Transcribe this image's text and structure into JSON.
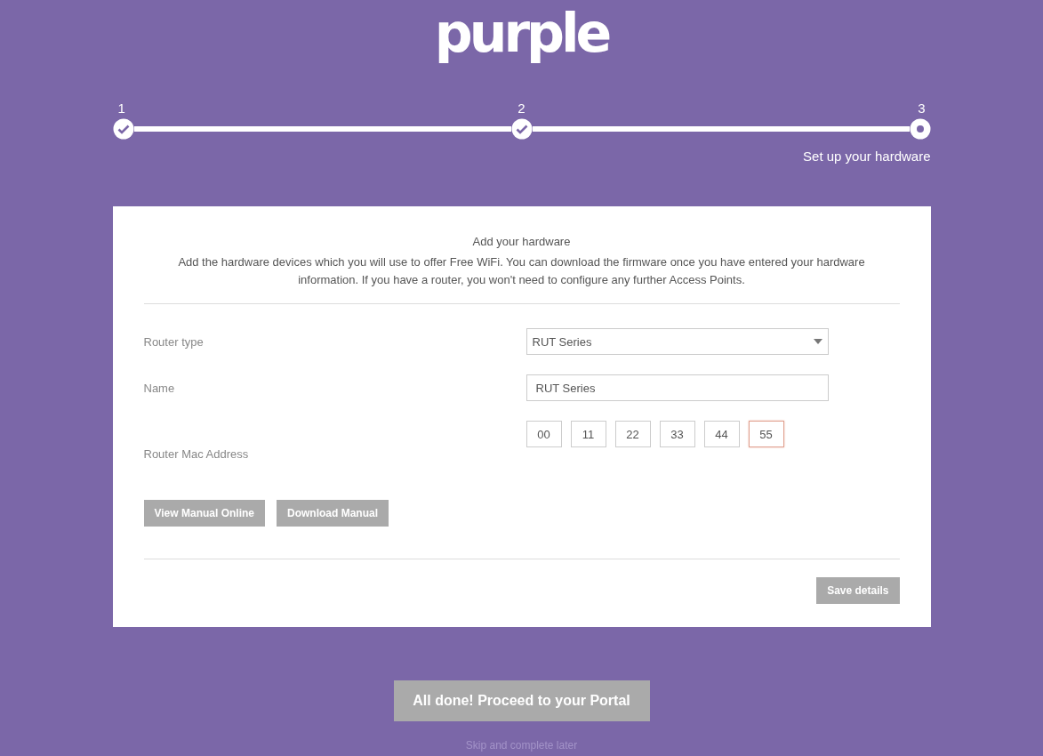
{
  "logo": {
    "text": "purple"
  },
  "steps": [
    {
      "number": "1",
      "completed": true
    },
    {
      "number": "2",
      "completed": true
    },
    {
      "number": "3",
      "completed": false
    }
  ],
  "step_caption": "Set up your hardware",
  "card": {
    "title": "Add your hardware",
    "description": "Add the hardware devices which you will use to offer Free WiFi. You can download the firmware once you have entered your hardware information. If you have a router, you won't need to configure any further Access Points.",
    "router_type": {
      "label": "Router type",
      "value": "RUT Series"
    },
    "name": {
      "label": "Name",
      "value": "RUT Series"
    },
    "mac_address": {
      "label": "Router Mac Address",
      "octets": [
        {
          "value": "00",
          "focused": false
        },
        {
          "value": "11",
          "focused": false
        },
        {
          "value": "22",
          "focused": false
        },
        {
          "value": "33",
          "focused": false
        },
        {
          "value": "44",
          "focused": false
        },
        {
          "value": "55",
          "focused": true
        }
      ]
    },
    "manual_buttons": [
      "View Manual Online",
      "Download Manual"
    ],
    "save_button": "Save details"
  },
  "proceed_button": "All done! Proceed to your Portal",
  "skip_link": "Skip and complete later"
}
